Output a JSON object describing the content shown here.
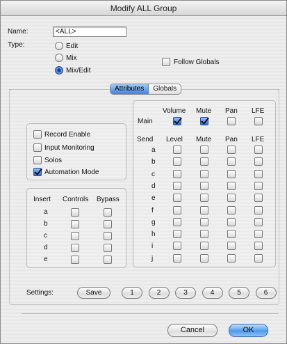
{
  "window": {
    "title": "Modify ALL Group"
  },
  "name": {
    "label": "Name:",
    "value": "<ALL>"
  },
  "type": {
    "label": "Type:",
    "options": [
      {
        "label": "Edit",
        "selected": false
      },
      {
        "label": "Mix",
        "selected": false
      },
      {
        "label": "Mix/Edit",
        "selected": true
      }
    ]
  },
  "follow_globals": {
    "label": "Follow Globals",
    "checked": false
  },
  "tabs": [
    {
      "label": "Attributes",
      "selected": true
    },
    {
      "label": "Globals",
      "selected": false
    }
  ],
  "attributes": [
    {
      "label": "Record Enable",
      "checked": false
    },
    {
      "label": "Input Monitoring",
      "checked": false
    },
    {
      "label": "Solos",
      "checked": false
    },
    {
      "label": "Automation Mode",
      "checked": true
    }
  ],
  "insert_table": {
    "headers": [
      "Insert",
      "Controls",
      "Bypass"
    ],
    "rows": [
      "a",
      "b",
      "c",
      "d",
      "e"
    ]
  },
  "main_table": {
    "row_label": "Main",
    "headers": [
      "Volume",
      "Mute",
      "Pan",
      "LFE"
    ],
    "checked": [
      true,
      true,
      false,
      false
    ]
  },
  "send_table": {
    "headers": [
      "Send",
      "Level",
      "Mute",
      "Pan",
      "LFE"
    ],
    "rows": [
      "a",
      "b",
      "c",
      "d",
      "e",
      "f",
      "g",
      "h",
      "i",
      "j"
    ]
  },
  "settings": {
    "label": "Settings:",
    "save_label": "Save",
    "slots": [
      "1",
      "2",
      "3",
      "4",
      "5",
      "6"
    ]
  },
  "footer": {
    "cancel_label": "Cancel",
    "ok_label": "OK"
  }
}
